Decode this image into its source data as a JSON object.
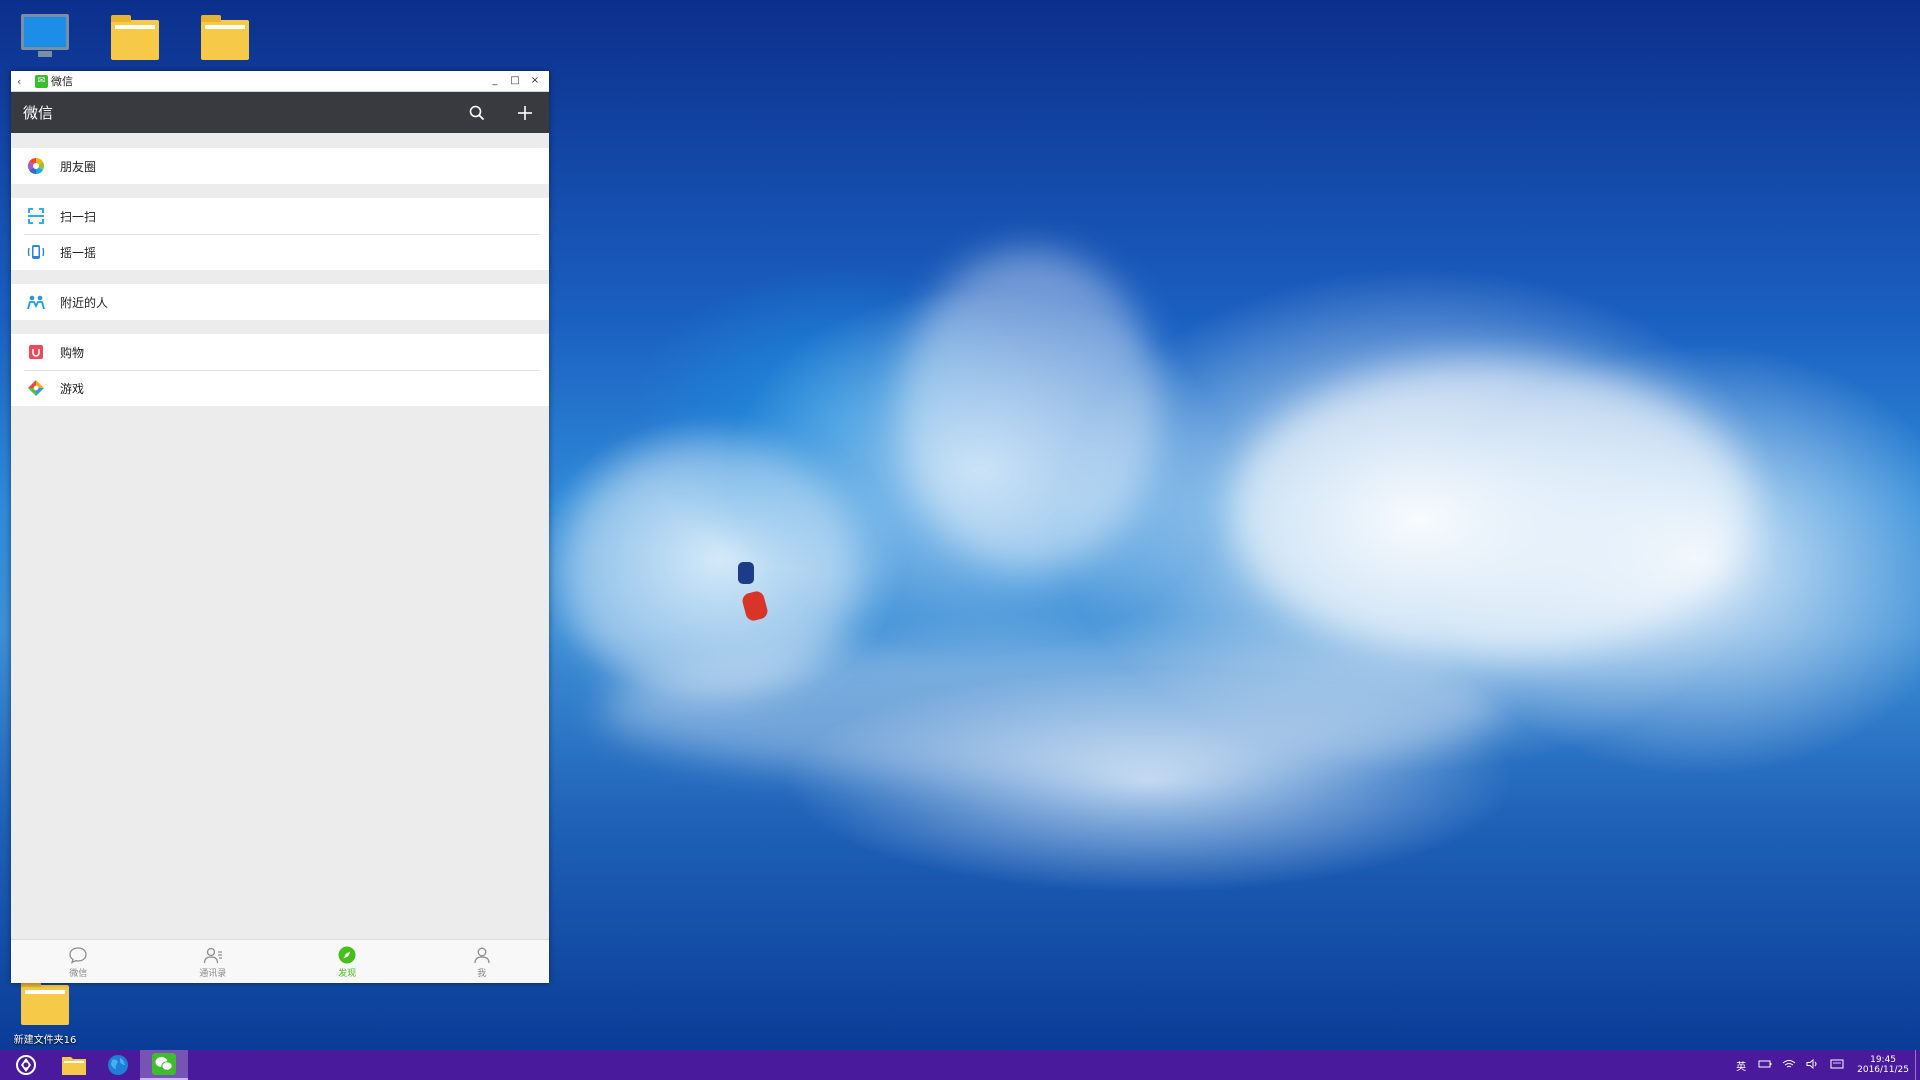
{
  "desktop": {
    "icons": [
      {
        "label": ""
      },
      {
        "label": ""
      },
      {
        "label": ""
      },
      {
        "label": "新建文件夹16"
      }
    ]
  },
  "window": {
    "title": "微信",
    "controls": {
      "minimize": "_",
      "maximize": "□",
      "close": "×",
      "back": "‹"
    }
  },
  "header": {
    "title": "微信",
    "search_icon": "search-icon",
    "add_icon": "plus-icon"
  },
  "discover": {
    "groups": [
      [
        {
          "label": "朋友圈",
          "icon": "moments-icon"
        }
      ],
      [
        {
          "label": "扫一扫",
          "icon": "scan-icon"
        },
        {
          "label": "摇一摇",
          "icon": "shake-icon"
        }
      ],
      [
        {
          "label": "附近的人",
          "icon": "nearby-people-icon"
        }
      ],
      [
        {
          "label": "购物",
          "icon": "shopping-icon"
        },
        {
          "label": "游戏",
          "icon": "games-icon"
        }
      ]
    ]
  },
  "tabs": [
    {
      "label": "微信",
      "icon": "chat-bubble-icon",
      "active": false
    },
    {
      "label": "通讯录",
      "icon": "contacts-icon",
      "active": false
    },
    {
      "label": "发现",
      "icon": "compass-icon",
      "active": true
    },
    {
      "label": "我",
      "icon": "person-icon",
      "active": false
    }
  ],
  "taskbar": {
    "ime": "英",
    "time": "19:45",
    "date": "2016/11/25"
  },
  "colors": {
    "wechat_green": "#45c01a",
    "header_bg": "#393a3f",
    "taskbar_bg": "#4a1a9c"
  }
}
